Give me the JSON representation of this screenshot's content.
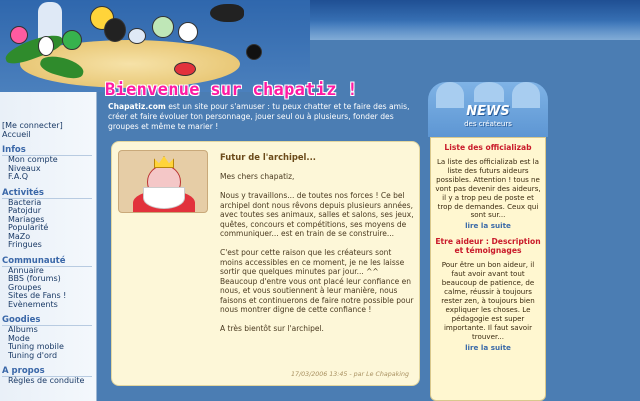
{
  "colors": {
    "background": "#4b7db3",
    "accent_pink": "#ff1aa3",
    "news_title_red": "#c91a2a",
    "link_blue": "#3b6aa8"
  },
  "nav": {
    "top_links": [
      "[Me connecter]",
      "Accueil"
    ],
    "sections": [
      {
        "title": "Infos",
        "items": [
          "Mon compte",
          "Niveaux",
          "F.A.Q"
        ]
      },
      {
        "title": "Activités",
        "items": [
          "Bacteria",
          "Patojdur",
          "Mariages",
          "Popularité",
          "MaZo",
          "Fringues"
        ]
      },
      {
        "title": "Communauté",
        "items": [
          "Annuaire",
          "BBS (forums)",
          "Groupes",
          "Sites de Fans !",
          "Evènements"
        ]
      },
      {
        "title": "Goodies",
        "items": [
          "Albums",
          "Mode",
          "Tuning mobile",
          "Tuning d'ord"
        ]
      },
      {
        "title": "A propos",
        "items": [
          "Règles de conduite"
        ]
      }
    ]
  },
  "welcome": {
    "title": "Bienvenue sur chapatiz !",
    "site_name": "Chapatiz.com",
    "intro": " est un site pour s'amuser : tu peux chatter et te faire des amis, créer et faire évoluer ton personnage, jouer seul ou à plusieurs, fonder des groupes et même te marier !"
  },
  "article": {
    "headline": "Futur de l'archipel...",
    "body": "Mes chers chapatiz,\n\nNous y travaillons... de toutes nos forces ! Ce bel archipel dont nous rêvons depuis plusieurs années, avec toutes ses animaux, salles et salons, ses jeux, quêtes, concours et compétitions, ses moyens de communiquer... est en train de se construire...\n\nC'est pour cette raison que les créateurs sont moins accessibles en ce moment, je ne les laisse sortir que quelques minutes par jour... ^^\nBeaucoup d'entre vous ont placé leur confiance en nous, et vous soutiennent à leur manière, nous faisons et continuerons de faire notre possible pour nous montrer digne de cette confiance !\n\nA très bientôt sur l'archipel.",
    "meta": "17/03/2006 13:45 - par Le Chapaking"
  },
  "news": {
    "logo_main": "NEWS",
    "logo_sub": "des créateurs",
    "items": [
      {
        "title": "Liste des officializab",
        "body": "La liste des officializab est la liste des futurs aideurs possibles. Attention ! tous ne vont pas devenir des aideurs, il y a trop peu de poste et trop de demandes. Ceux qui sont sur...",
        "more": "lire la suite"
      },
      {
        "title": "Etre aideur : Description et témoignages",
        "body": "Pour être un bon aideur, il faut avoir avant tout beaucoup de patience, de calme, réussir à toujours rester zen, à toujours bien expliquer les choses. Le pédagogie est super importante. Il faut savoir trouver...",
        "more": "lire la suite"
      }
    ]
  },
  "icons": [
    "island-banner-icon",
    "king-avatar-icon",
    "bird-icon"
  ]
}
